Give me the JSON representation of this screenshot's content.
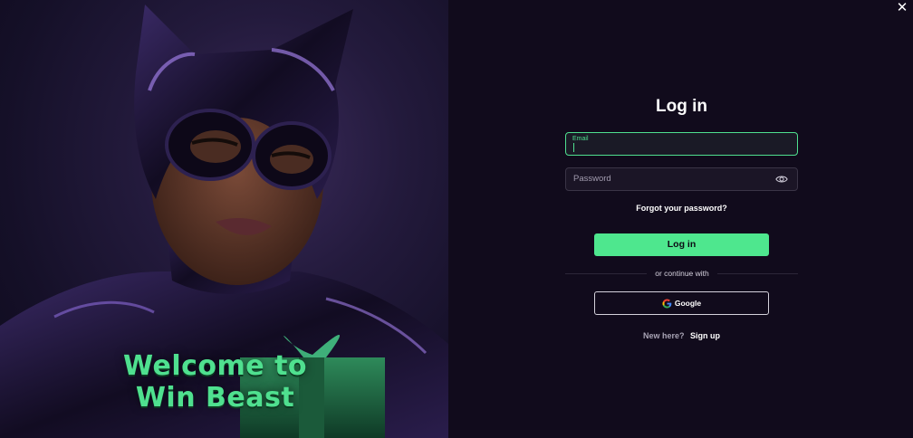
{
  "hero": {
    "welcome_line1": "Welcome to",
    "welcome_line2": "Win Beast",
    "image_subject": "woman-in-catsuit-mask-illustration"
  },
  "window": {
    "close_icon": "close-icon",
    "close_glyph": "✕"
  },
  "login_form": {
    "title": "Log in",
    "email_label": "Email",
    "password_placeholder": "Password",
    "password_toggle_icon": "eye-icon",
    "forgot_password": "Forgot your password?",
    "submit_label": "Log in",
    "divider_text": "or continue with",
    "google_label": "Google",
    "new_here": "New here?",
    "signup_label": "Sign up"
  },
  "colors": {
    "accent": "#4ee78e",
    "background": "#110b1c",
    "field_bg": "#1b1526",
    "welcome_text": "#4fe08f"
  }
}
